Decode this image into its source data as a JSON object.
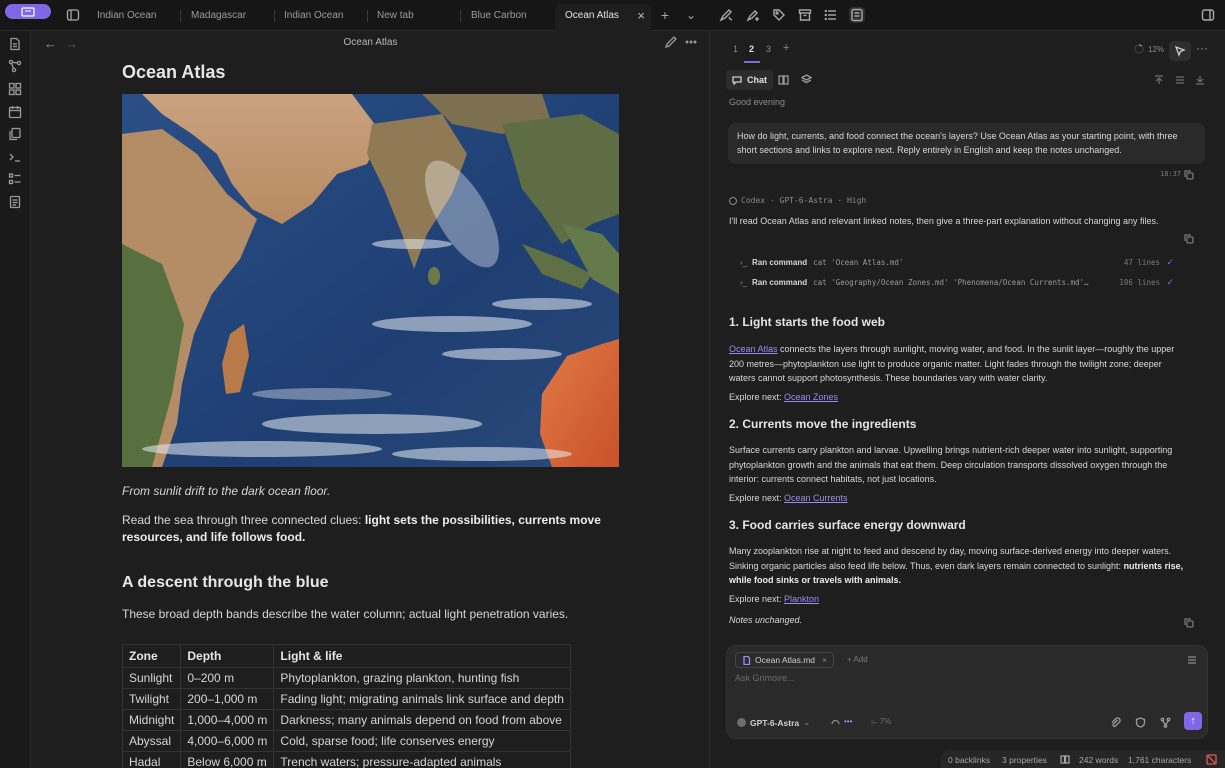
{
  "tabs": [
    {
      "label": "Indian Ocean",
      "active": false
    },
    {
      "label": "Madagascar",
      "active": false
    },
    {
      "label": "Indian Ocean",
      "active": false
    },
    {
      "label": "New tab",
      "active": false
    },
    {
      "label": "Blue Carbon",
      "active": false
    },
    {
      "label": "Ocean Atlas",
      "active": true
    }
  ],
  "tab_close": "×",
  "tab_add": "+",
  "tab_menu": "⌄",
  "editor": {
    "breadcrumb_title": "Ocean Atlas",
    "h1": "Ocean Atlas",
    "image_alt": "Satellite view of the Indian Ocean",
    "caption": "From sunlit drift to the dark ocean floor.",
    "para1_plain": "Read the sea through three connected clues: ",
    "para1_bold": "light sets the possibilities, currents move resources, and life follows food.",
    "h2": "A descent through the blue",
    "para2": "These broad depth bands describe the water column; actual light penetration varies.",
    "table": {
      "headers": [
        "Zone",
        "Depth",
        "Light & life"
      ],
      "rows": [
        [
          "Sunlight",
          "0–200 m",
          "Phytoplankton, grazing plankton, hunting fish"
        ],
        [
          "Twilight",
          "200–1,000 m",
          "Fading light; migrating animals link surface and depth"
        ],
        [
          "Midnight",
          "1,000–4,000 m",
          "Darkness; many animals depend on food from above"
        ],
        [
          "Abyssal",
          "4,000–6,000 m",
          "Cold, sparse food; life conserves energy"
        ],
        [
          "Hadal",
          "Below 6,000 m",
          "Trench waters; pressure-adapted animals"
        ]
      ]
    }
  },
  "panel": {
    "tabs": [
      "1",
      "2",
      "3",
      "+"
    ],
    "active_tab": "2",
    "progress": "12%",
    "progress_fraction": 0.12,
    "chat_tab": "Chat",
    "greeting": "Good evening",
    "user_message": "How do light, currents, and food connect the ocean's layers? Use Ocean Atlas as your starting point, with three short sections and links to explore next. Reply entirely in English and keep the notes unchanged.",
    "message_time": "18:37",
    "meta": "Codex · GPT-6-Astra · High",
    "intro": "I'll read Ocean Atlas and relevant linked notes, then give a three-part explanation without changing any files.",
    "commands": [
      {
        "label": "Ran command",
        "code": "cat 'Ocean Atlas.md'",
        "lines": "47 lines"
      },
      {
        "label": "Ran command",
        "code": "cat 'Geography/Ocean Zones.md' 'Phenomena/Ocean Currents.md'…",
        "lines": "106 lines"
      }
    ],
    "explore_label": "Explore next: ",
    "sections": [
      {
        "heading": "1. Light starts the food web",
        "link_lead": "Ocean Atlas",
        "body": " connects the layers through sunlight, moving water, and food. In the sunlit layer—roughly the upper 200 metres—phytoplankton use light to produce organic matter. Light fades through the twilight zone; deeper waters cannot support photosynthesis. These boundaries vary with water clarity.",
        "explore_link": "Ocean Zones"
      },
      {
        "heading": "2. Currents move the ingredients",
        "body": "Surface currents carry plankton and larvae. Upwelling brings nutrient-rich deeper water into sunlight, supporting phytoplankton growth and the animals that eat them. Deep circulation transports dissolved oxygen through the interior: currents connect habitats, not just locations.",
        "explore_link": "Ocean Currents"
      },
      {
        "heading": "3. Food carries surface energy downward",
        "body": "Many zooplankton rise at night to feed and descend by day, moving surface-derived energy into deeper waters. Sinking organic particles also feed life below. Thus, even dark layers remain connected to sunlight: ",
        "body_bold": "nutrients rise, while food sinks or travels with animals.",
        "explore_link": "Plankton"
      }
    ],
    "notes": "Notes unchanged.",
    "composer": {
      "file_chip": "Ocean Atlas.md",
      "add_label": "+ Add",
      "placeholder": "Ask Grimoire...",
      "model": "GPT-6-Astra",
      "effort_dots": "•••",
      "context": "7%",
      "send": "↑"
    }
  },
  "status": {
    "backlinks": "0 backlinks",
    "properties": "3 properties",
    "words": "242 words",
    "characters": "1,761 characters"
  },
  "colors": {
    "accent": "#7e68e8",
    "link": "#9b8cf2",
    "background": "#1e1e1e",
    "error": "#e25757"
  }
}
